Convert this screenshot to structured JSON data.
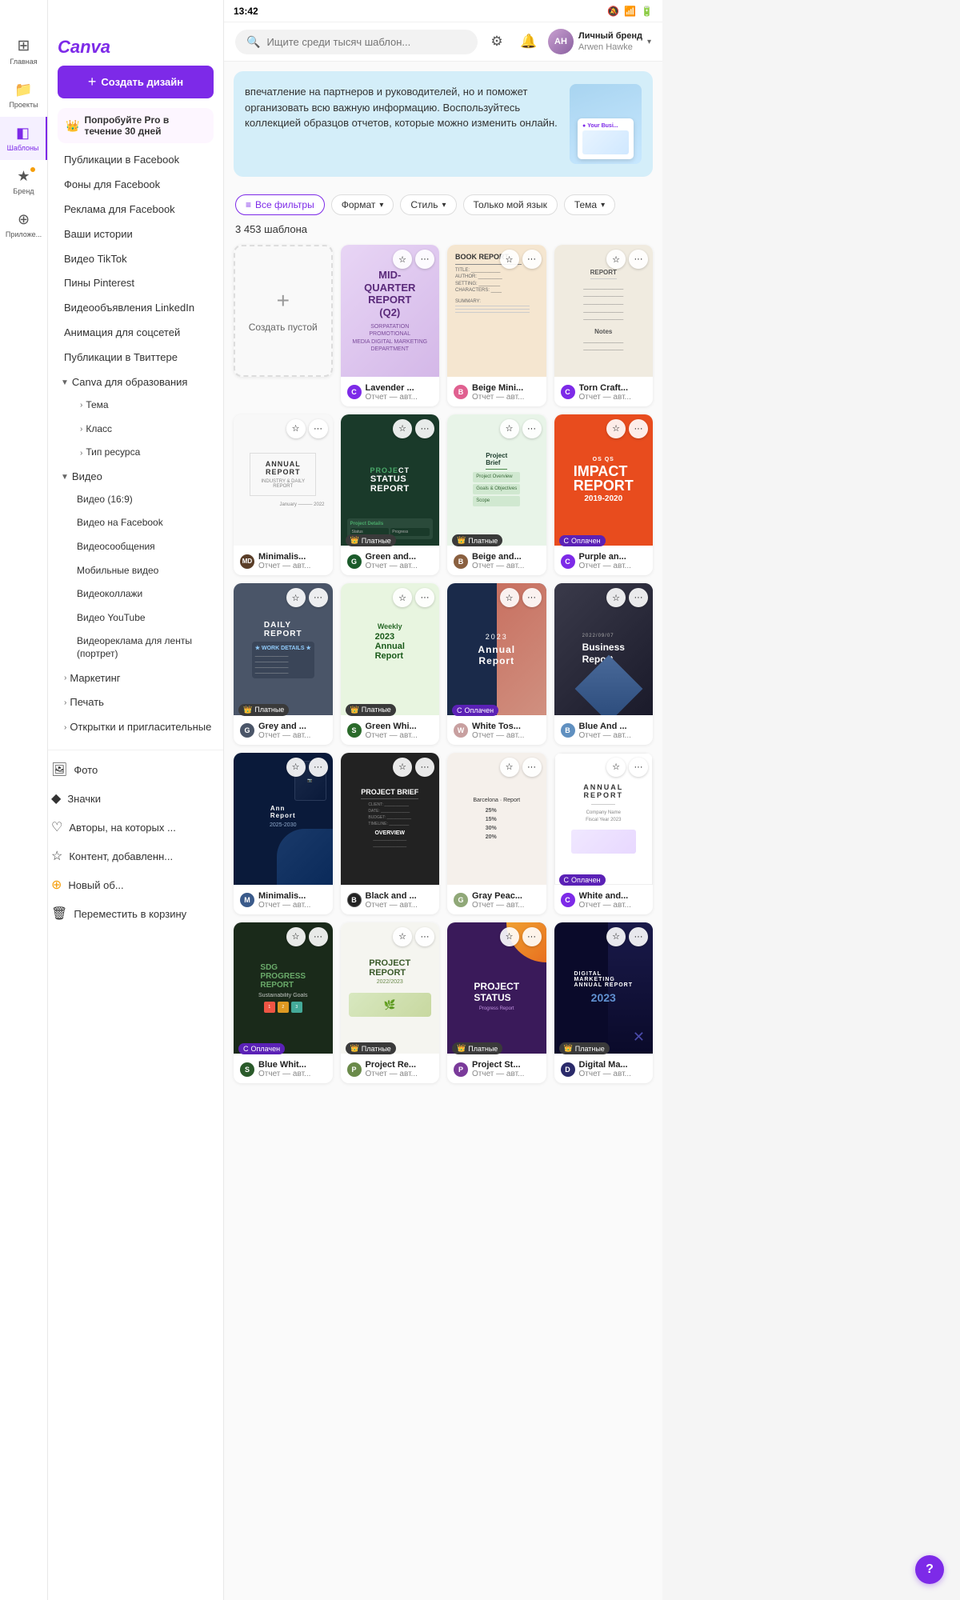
{
  "status_bar": {
    "time": "13:42",
    "icons": [
      "🔔",
      "📶",
      "🔋"
    ]
  },
  "logo": "Canva",
  "create_button": "+ Создать дизайн",
  "pro_banner": {
    "icon": "👑",
    "text": "Попробуйте Pro в течение 30 дней"
  },
  "nav_items": [
    {
      "id": "home",
      "label": "Главная",
      "icon": "⊞"
    },
    {
      "id": "projects",
      "label": "Проекты",
      "icon": "📁"
    },
    {
      "id": "templates",
      "label": "Шаблоны",
      "icon": "◧",
      "active": true
    },
    {
      "id": "brand",
      "label": "Бренд",
      "icon": "★"
    },
    {
      "id": "apps",
      "label": "Приложе...",
      "icon": "⊕"
    }
  ],
  "sidebar": {
    "items": [
      {
        "label": "Публикации в Facebook",
        "type": "link"
      },
      {
        "label": "Фоны для Facebook",
        "type": "link"
      },
      {
        "label": "Реклама для Facebook",
        "type": "link"
      },
      {
        "label": "Ваши истории",
        "type": "link"
      },
      {
        "label": "Видео TikTok",
        "type": "link"
      },
      {
        "label": "Пины Pinterest",
        "type": "link"
      },
      {
        "label": "Видеообъявления LinkedIn",
        "type": "link"
      },
      {
        "label": "Анимация для соцсетей",
        "type": "link"
      },
      {
        "label": "Публикации в Твиттере",
        "type": "link"
      },
      {
        "label": "Canva для образования",
        "type": "category",
        "expanded": true,
        "children": [
          {
            "label": "Тема",
            "type": "subcategory"
          },
          {
            "label": "Класс",
            "type": "subcategory"
          },
          {
            "label": "Тип ресурса",
            "type": "subcategory"
          }
        ]
      },
      {
        "label": "Видео",
        "type": "category",
        "expanded": true,
        "children": [
          {
            "label": "Видео (16:9)",
            "type": "link"
          },
          {
            "label": "Видео на Facebook",
            "type": "link"
          },
          {
            "label": "Видеосообщения",
            "type": "link"
          },
          {
            "label": "Мобильные видео",
            "type": "link"
          },
          {
            "label": "Видеоколлажи",
            "type": "link"
          },
          {
            "label": "Видео YouTube",
            "type": "link"
          },
          {
            "label": "Видеореклама для ленты (портрет)",
            "type": "link"
          }
        ]
      },
      {
        "label": "Маркетинг",
        "type": "subcategory"
      },
      {
        "label": "Печать",
        "type": "subcategory"
      },
      {
        "label": "Открытки и пригласительные",
        "type": "subcategory"
      }
    ],
    "bottom_items": [
      {
        "id": "photo",
        "label": "Фото",
        "icon": "🖼"
      },
      {
        "id": "icons",
        "label": "Значки",
        "icon": "◆"
      },
      {
        "id": "authors",
        "label": "Авторы, на которых ...",
        "icon": "♡"
      },
      {
        "id": "content",
        "label": "Контент, добавленн...",
        "icon": "☆"
      },
      {
        "id": "new",
        "label": "Новый об...",
        "icon": "+"
      },
      {
        "id": "trash",
        "label": "Переместить в корзину",
        "icon": "🗑"
      }
    ]
  },
  "search": {
    "placeholder": "Ищите среди тысяч шаблон..."
  },
  "user": {
    "name": "Личный бренд",
    "sub": "Arwen Hawke",
    "avatar_initials": "AH"
  },
  "banner": {
    "text": "впечатление на партнеров и руководителей, но и поможет организовать всю важную информацию. Воспользуйтесь коллекцией образцов отчетов, которые можно изменить онлайн.",
    "card_title": "Your Busi..."
  },
  "filters": [
    {
      "id": "all",
      "label": "Все фильтры",
      "icon": "⚙",
      "active": true
    },
    {
      "id": "format",
      "label": "Формат",
      "has_arrow": true
    },
    {
      "id": "style",
      "label": "Стиль",
      "has_arrow": true
    },
    {
      "id": "language",
      "label": "Только мой язык"
    },
    {
      "id": "theme",
      "label": "Тема",
      "has_arrow": true
    }
  ],
  "results_count": "3 453 шаблона",
  "templates": [
    {
      "id": "create-empty",
      "type": "empty",
      "label": "Создать пустой"
    },
    {
      "id": "mid-quarter",
      "name": "Lavender ...",
      "type_label": "Отчет — авт...",
      "bg": "lavender",
      "author_color": "#7d2ae8",
      "author_initial": "C",
      "content": "MID-QUARTER REPORT (Q2)",
      "badge": null
    },
    {
      "id": "beige-mini",
      "name": "Beige Mini...",
      "type_label": "Отчет — авт...",
      "bg": "beige",
      "author_color": "#e06090",
      "author_initial": "B",
      "content": "BOOK REPORT",
      "badge": null
    },
    {
      "id": "torn-craft",
      "name": "Torn Craft...",
      "type_label": "Отчет — авт...",
      "bg": "torn",
      "author_color": "#7d2ae8",
      "author_initial": "C",
      "content": "",
      "badge": null
    },
    {
      "id": "minimalist-annual",
      "name": "Minimalis...",
      "type_label": "Отчет — авт...",
      "bg": "minimal-white",
      "author_color": "#5a3e28",
      "author_initial": "M",
      "content": "ANNUAL REPORT",
      "badge": null
    },
    {
      "id": "green-and",
      "name": "Green and...",
      "type_label": "Отчет — авт...",
      "bg": "dark-green",
      "author_color": "#1a3a2a",
      "author_initial": "G",
      "content": "PROJECT STATUS REPORT",
      "badge": "paid"
    },
    {
      "id": "beige-and",
      "name": "Beige and...",
      "type_label": "Отчет — авт...",
      "bg": "beige",
      "author_color": "#8a6040",
      "author_initial": "B",
      "content": "Project Brief",
      "badge": "paid"
    },
    {
      "id": "purple-and",
      "name": "Purple an...",
      "type_label": "Отчет — авт...",
      "bg": "impact-orange",
      "author_color": "#7d2ae8",
      "author_initial": "C",
      "content": "IMPACT REPORT 2019-2020",
      "badge": "paid-purple"
    },
    {
      "id": "grey-and",
      "name": "Grey and ...",
      "type_label": "Отчет — авт...",
      "bg": "daily-grey",
      "author_color": "#4a5568",
      "author_initial": "G",
      "content": "DAILY REPORT",
      "badge": "paid"
    },
    {
      "id": "green-whi",
      "name": "Green Whi...",
      "type_label": "Отчет — авт...",
      "bg": "weekly-green",
      "author_color": "#2a6a2a",
      "author_initial": "S",
      "content": "Weekly Report 2023",
      "badge": "paid"
    },
    {
      "id": "white-tos",
      "name": "White Tos...",
      "type_label": "Отчет — авт...",
      "bg": "annual-blue",
      "author_color": "#c8a0a0",
      "author_initial": "W",
      "content": "Annual Report 2023",
      "badge": "paid-purple"
    },
    {
      "id": "blue-and",
      "name": "Blue And ...",
      "type_label": "Отчет — авт...",
      "bg": "business-dark",
      "author_color": "#6090c0",
      "author_initial": "B",
      "content": "Business Report",
      "badge": null
    },
    {
      "id": "minimalist2",
      "name": "Minimalis...",
      "type_label": "Отчет — авт...",
      "bg": "annual-dark-blue",
      "author_color": "#3a5a8a",
      "author_initial": "M",
      "content": "Annual Report 2025-2030",
      "badge": null
    },
    {
      "id": "black-and",
      "name": "Black and ...",
      "type_label": "Отчет — авт...",
      "bg": "black-white",
      "author_color": "#222",
      "author_initial": "B",
      "content": "PROJECT BRIEF",
      "badge": null
    },
    {
      "id": "gray-peach",
      "name": "Gray Peac...",
      "type_label": "Отчет — авт...",
      "bg": "gray-peach",
      "author_color": "#90a878",
      "author_initial": "G",
      "content": "25% 15% 30% 20%",
      "badge": null
    },
    {
      "id": "white-and",
      "name": "White and...",
      "type_label": "Отчет — авт...",
      "bg": "white-annual",
      "author_color": "#7d2ae8",
      "author_initial": "C",
      "content": "ANNUAL REPORT",
      "badge": "paid-purple"
    },
    {
      "id": "sdg",
      "name": "Blue Whit...",
      "type_label": "Отчет — авт...",
      "bg": "sdg-dark",
      "author_color": "#2a5a2a",
      "author_initial": "S",
      "content": "SDG PROGRESS REPORT",
      "badge": "paid-purple"
    },
    {
      "id": "project-report",
      "name": "Project Re...",
      "type_label": "Отчет — авт...",
      "bg": "project-report",
      "author_color": "#6a8a4a",
      "author_initial": "P",
      "content": "PROJECT REPORT 2022/2023",
      "badge": "paid"
    },
    {
      "id": "project-status2",
      "name": "Project St...",
      "type_label": "Отчет — авт...",
      "bg": "project-status2",
      "author_color": "#7a3a9a",
      "author_initial": "P",
      "content": "PROJECT STATUS",
      "badge": "paid"
    },
    {
      "id": "digital-marketing",
      "name": "Digital Ma...",
      "type_label": "Отчет — авт...",
      "bg": "digital-marketing",
      "author_color": "#2a2a6a",
      "author_initial": "D",
      "content": "DIGITAL MARKETING ANNUAL REPORT 2023",
      "badge": "paid"
    }
  ],
  "badge_labels": {
    "paid": "👑 Платные",
    "paid_purple": "C Оплачен"
  }
}
